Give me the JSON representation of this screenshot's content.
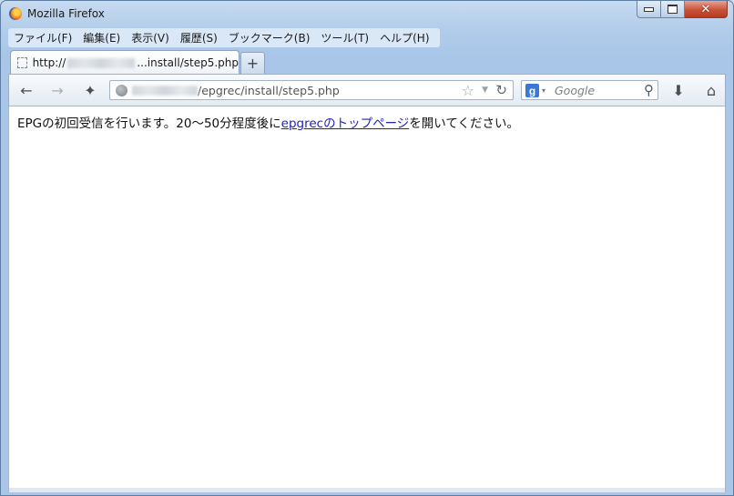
{
  "window": {
    "title": "Mozilla Firefox",
    "min_symbol": "",
    "close_symbol": "✕"
  },
  "menu": {
    "items": [
      "ファイル(F)",
      "編集(E)",
      "表示(V)",
      "履歴(S)",
      "ブックマーク(B)",
      "ツール(T)",
      "ヘルプ(H)"
    ]
  },
  "tab": {
    "prefix": "http://",
    "suffix": "...install/step5.php",
    "new_tab_symbol": "+"
  },
  "nav": {
    "back_icon": "←",
    "forward_icon": "→",
    "tools_icon": "✦",
    "url_path": "/epgrec/install/step5.php",
    "star_icon": "☆",
    "dropdown_icon": "▼",
    "reload_icon": "↻",
    "search_engine_letter": "g",
    "search_caret": "▾",
    "search_placeholder": "Google",
    "search_icon": "⚲",
    "download_icon": "⬇",
    "home_icon": "⌂"
  },
  "page": {
    "text_before": "EPGの初回受信を行います。20〜50分程度後に",
    "link_text": "epgrecのトップページ",
    "text_after": "を開いてください。"
  },
  "colors": {
    "link": "#2020c0",
    "window_frame": "#b3cdea"
  }
}
